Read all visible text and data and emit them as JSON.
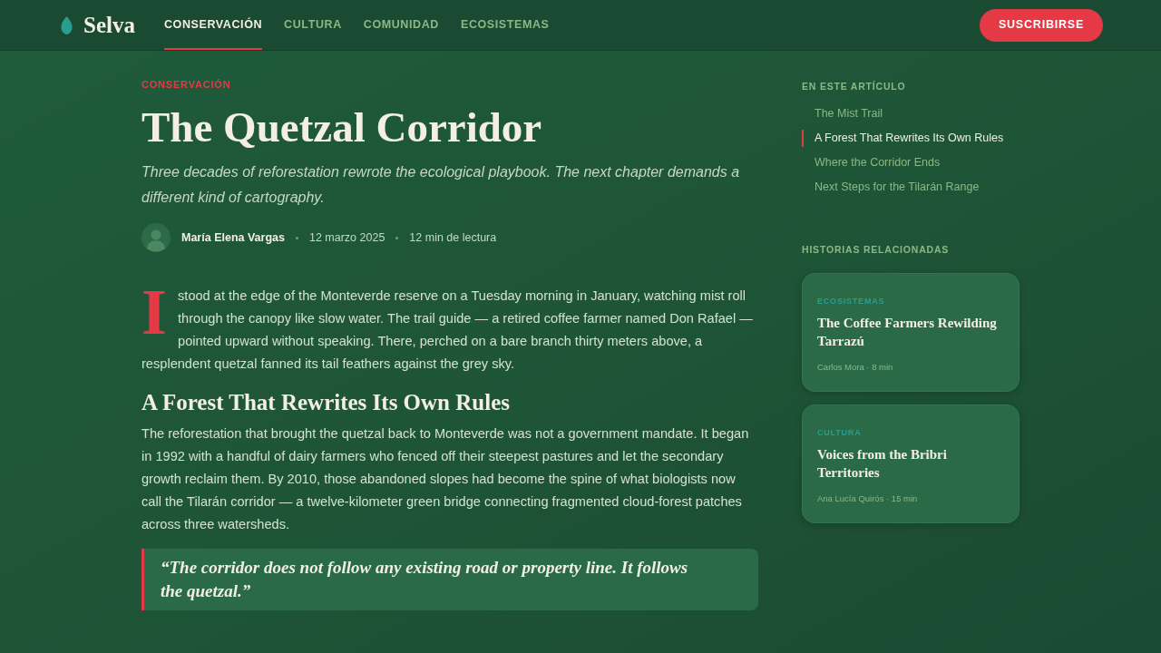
{
  "header": {
    "logo": "Selva",
    "nav": [
      {
        "label": "CONSERVACIÓN",
        "selected": true
      },
      {
        "label": "CULTURA",
        "selected": false
      },
      {
        "label": "COMUNIDAD",
        "selected": false
      },
      {
        "label": "ECOSISTEMAS",
        "selected": false
      }
    ],
    "subscribe_button": "SUSCRIBIRSE"
  },
  "article": {
    "category": "CONSERVACIÓN",
    "title": "The Quetzal Corridor",
    "subtitle": "Three decades of reforestation rewrote the ecological playbook. The next chapter demands a different kind of cartography.",
    "author": "María Elena Vargas",
    "date": "12 marzo 2025",
    "read_time": "12 min de lectura",
    "body": [
      {
        "kind": "paragraph",
        "drop_cap": true,
        "text": "I stood at the edge of the Monteverde reserve on a Tuesday morning in January, watching mist roll through the canopy like slow water. The trail guide — a retired coffee farmer named Don Rafael — pointed upward without speaking. There, perched on a bare branch thirty meters above, a resplendent quetzal fanned its tail feathers against the grey sky."
      },
      {
        "kind": "heading",
        "text": "A Forest That Rewrites Its Own Rules"
      },
      {
        "kind": "paragraph",
        "drop_cap": false,
        "text": "The reforestation that brought the quetzal back to Monteverde was not a government mandate. It began in 1992 with a handful of dairy farmers who fenced off their steepest pastures and let the secondary growth reclaim them. By 2010, those abandoned slopes had become the spine of what biologists now call the Tilarán corridor — a twelve-kilometer green bridge connecting fragmented cloud-forest patches across three watersheds."
      },
      {
        "kind": "quote",
        "text": "“The corridor does not follow any existing road or property line. It follows the quetzal.”"
      }
    ]
  },
  "sidebar": {
    "toc_heading": "EN ESTE ARTÍCULO",
    "toc": [
      {
        "label": "The Mist Trail",
        "selected": false
      },
      {
        "label": "A Forest That Rewrites Its Own Rules",
        "selected": true
      },
      {
        "label": "Where the Corridor Ends",
        "selected": false
      },
      {
        "label": "Next Steps for the Tilarán Range",
        "selected": false
      }
    ],
    "related_heading": "HISTORIAS RELACIONADAS",
    "related": [
      {
        "category": "ECOSISTEMAS",
        "title": "The Coffee Farmers Rewilding Tarrazú",
        "meta": "Carlos Mora · 8 min"
      },
      {
        "category": "CULTURA",
        "title": "Voices from the Bribri Territories",
        "meta": "Ana Lucía Quirós · 15 min"
      }
    ]
  }
}
